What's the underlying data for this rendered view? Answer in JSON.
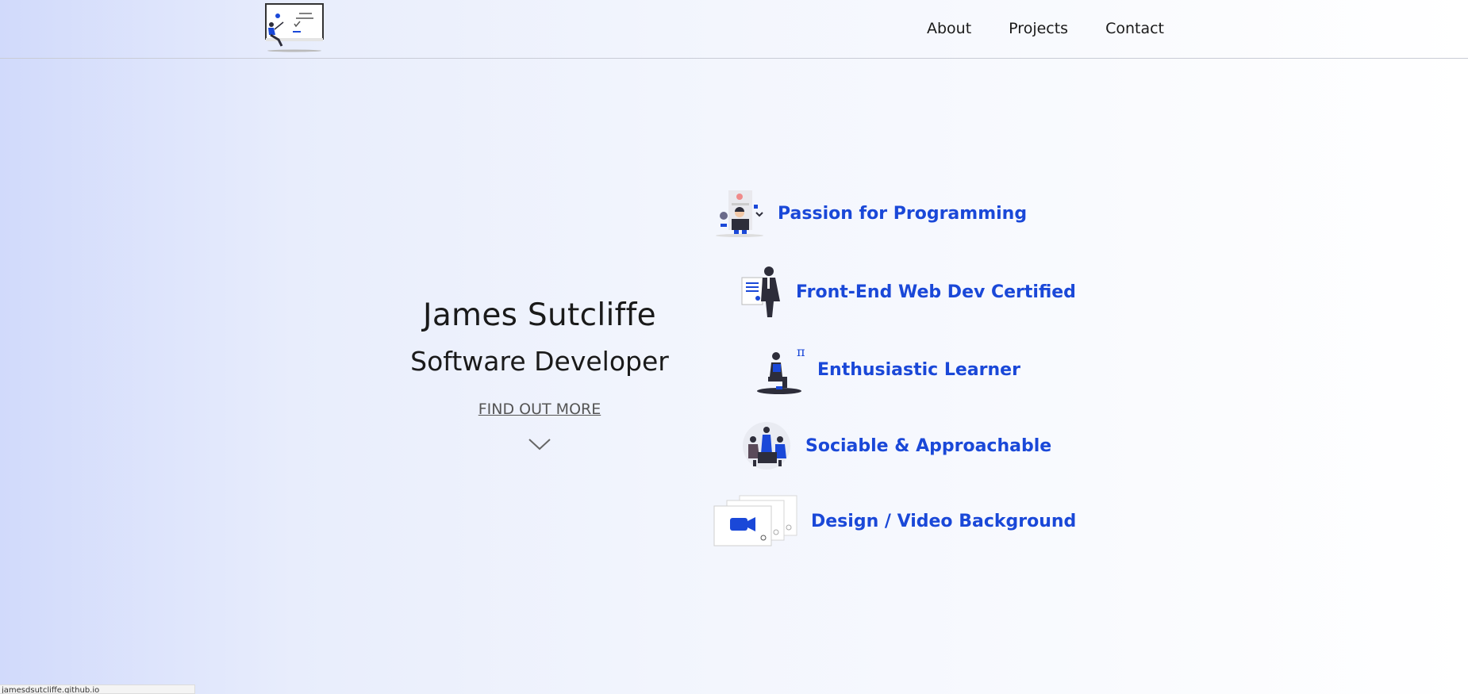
{
  "header": {
    "logo_icon": "developer-at-whiteboard-illustration",
    "nav": [
      {
        "label": "About"
      },
      {
        "label": "Projects"
      },
      {
        "label": "Contact"
      }
    ]
  },
  "hero": {
    "name": "James Sutcliffe",
    "role": "Software Developer",
    "cta": "FIND OUT MORE",
    "cta_icon": "chevron-down-icon"
  },
  "features": [
    {
      "label": "Passion for Programming",
      "icon": "programming-illustration"
    },
    {
      "label": "Front-End Web Dev Certified",
      "icon": "certificate-illustration"
    },
    {
      "label": "Enthusiastic Learner",
      "icon": "learner-pi-illustration"
    },
    {
      "label": "Sociable & Approachable",
      "icon": "team-meeting-illustration"
    },
    {
      "label": "Design / Video Background",
      "icon": "video-camera-illustration"
    }
  ],
  "status_bar": {
    "text": "jamesdsutcliffe.github.io"
  },
  "colors": {
    "accent": "#1a48d8",
    "text": "#1a1a1a",
    "gradient_start": "#d1dafb",
    "gradient_end": "#ffffff"
  }
}
